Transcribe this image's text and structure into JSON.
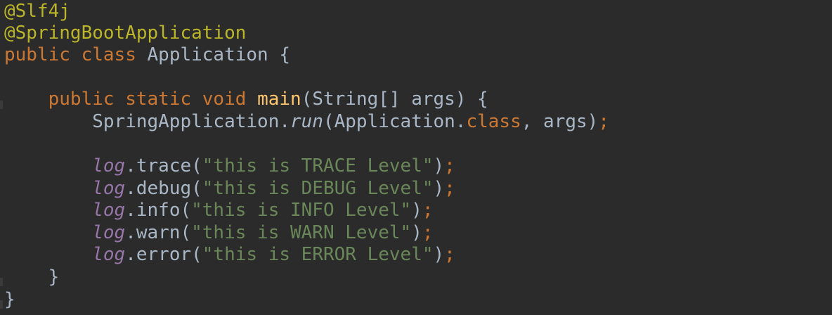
{
  "code": {
    "annotation_slf4j": "@Slf4j",
    "annotation_spring": "@SpringBootApplication",
    "kw_public": "public",
    "kw_class": "class",
    "class_name": "Application",
    "brace_open": "{",
    "brace_close": "}",
    "kw_static": "static",
    "kw_void": "void",
    "method_main": "main",
    "main_params": "(String[] args)",
    "spring_app": "SpringApplication.",
    "run": "run",
    "run_args_start": "(Application.",
    "kw_class_literal": "class",
    "run_args_end": ", args)",
    "semicolon": ";",
    "log": "log",
    "trace_call": ".trace(",
    "trace_msg": "\"this is TRACE Level\"",
    "debug_call": ".debug(",
    "debug_msg": "\"this is DEBUG Level\"",
    "info_call": ".info(",
    "info_msg": "\"this is INFO Level\"",
    "warn_call": ".warn(",
    "warn_msg": "\"this is WARN Level\"",
    "error_call": ".error(",
    "error_msg": "\"this is ERROR Level\"",
    "close_paren": ")"
  },
  "colors": {
    "background": "#2b2b2b",
    "keyword": "#cc7832",
    "annotation": "#bbb529",
    "method": "#ffc66d",
    "string": "#6a8759",
    "field": "#9876aa",
    "text": "#a9b7c6"
  }
}
